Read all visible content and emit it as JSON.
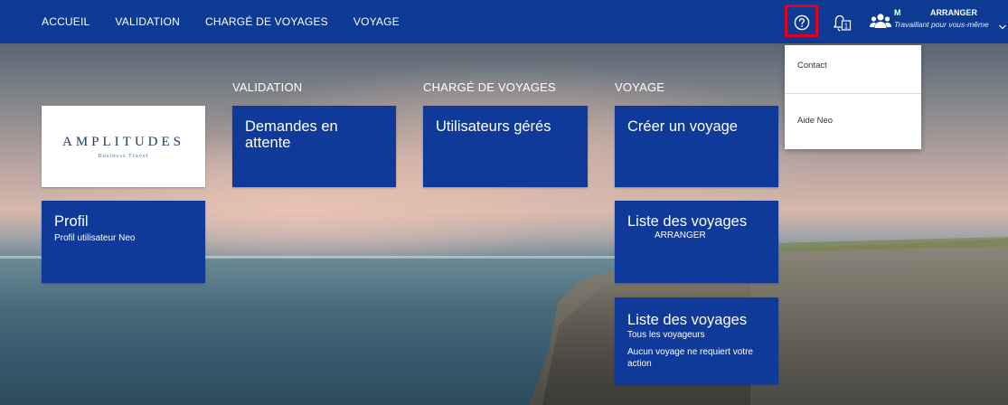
{
  "nav": {
    "items": [
      "ACCUEIL",
      "VALIDATION",
      "CHARGÉ DE VOYAGES",
      "VOYAGE"
    ],
    "notification_count": "1",
    "user": {
      "first_name": "M",
      "last_name": "ARRANGER",
      "subtitle": "Travaillant pour vous-même"
    }
  },
  "help_menu": {
    "items": [
      "Contact",
      "Aide Neo"
    ]
  },
  "sections": {
    "validation": "VALIDATION",
    "charge": "CHARGÉ DE VOYAGES",
    "voyage": "VOYAGE"
  },
  "logo": {
    "main": "AMPLITUDES",
    "sub": "Business Travel"
  },
  "tiles": {
    "profil": {
      "title": "Profil",
      "sub": "Profil utilisateur Neo"
    },
    "demandes": {
      "title": "Demandes en attente"
    },
    "utilisateurs": {
      "title": "Utilisateurs gérés"
    },
    "creer": {
      "title": "Créer un voyage"
    },
    "liste_arranger": {
      "title": "Liste des voyages",
      "sub": "ARRANGER"
    },
    "liste_tous": {
      "title": "Liste des voyages",
      "sub": "Tous les voyageurs",
      "note": "Aucun voyage ne requiert votre action"
    }
  },
  "colors": {
    "nav_bg": "#0d3a93",
    "tile_bg": "#0f3a99",
    "highlight": "#e1001e"
  },
  "icons": [
    "help-circle-icon",
    "bell-icon",
    "users-icon",
    "chevron-down-icon"
  ]
}
